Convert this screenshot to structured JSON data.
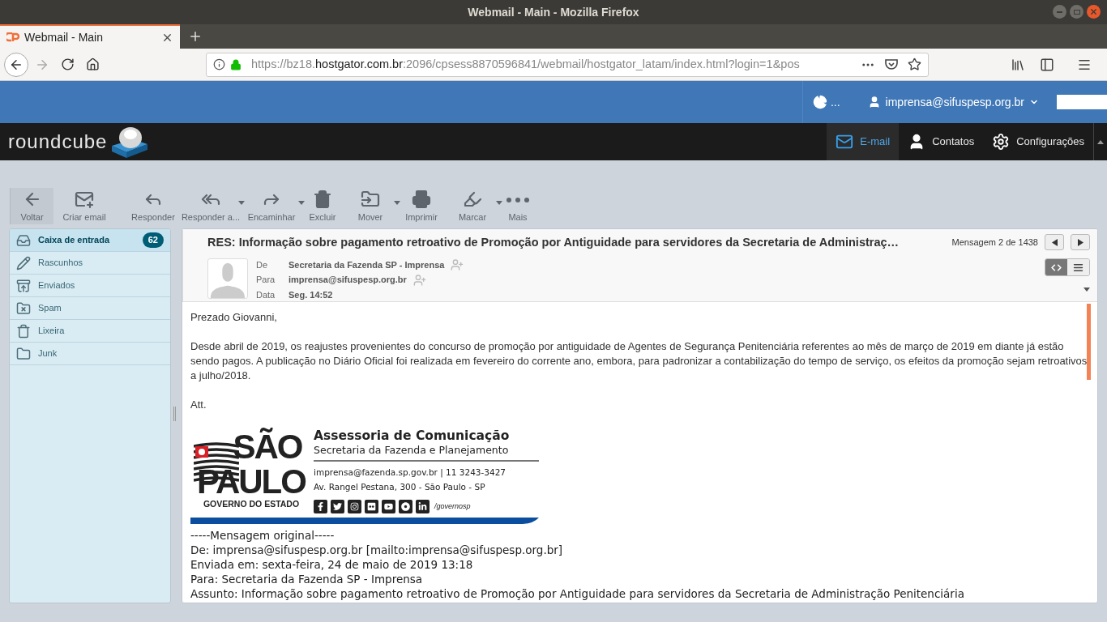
{
  "browser": {
    "window_title": "Webmail - Main - Mozilla Firefox",
    "tab_title": "Webmail - Main",
    "url": {
      "prefix": "https://bz18.",
      "domain": "hostgator.com.br",
      "path": ":2096/cpsess8870596841/webmail/hostgator_latam/index.html?login=1&pos"
    }
  },
  "header": {
    "quota": "...",
    "user": "imprensa@sifuspesp.org.br"
  },
  "logo": {
    "text": "roundcube"
  },
  "nav": [
    {
      "label": "E-mail",
      "kind": "mail",
      "selected": true
    },
    {
      "label": "Contatos",
      "kind": "user",
      "selected": false
    },
    {
      "label": "Configurações",
      "kind": "gear",
      "selected": false
    }
  ],
  "toolbar": [
    {
      "label": "Voltar",
      "kind": "back",
      "dropdown": false
    },
    {
      "label": "Criar email",
      "kind": "compose",
      "dropdown": false
    },
    {
      "label": "Responder",
      "kind": "reply",
      "dropdown": false
    },
    {
      "label": "Responder a...",
      "kind": "reply-all",
      "dropdown": true
    },
    {
      "label": "Encaminhar",
      "kind": "forward",
      "dropdown": true
    },
    {
      "label": "Excluir",
      "kind": "delete",
      "dropdown": false
    },
    {
      "label": "Mover",
      "kind": "move",
      "dropdown": true
    },
    {
      "label": "Imprimir",
      "kind": "print",
      "dropdown": false
    },
    {
      "label": "Marcar",
      "kind": "mark",
      "dropdown": true
    },
    {
      "label": "Mais",
      "kind": "more",
      "dropdown": false
    }
  ],
  "folders": [
    {
      "label": "Caixa de entrada",
      "kind": "inbox",
      "selected": true,
      "count": "62"
    },
    {
      "label": "Rascunhos",
      "kind": "drafts",
      "selected": false
    },
    {
      "label": "Enviados",
      "kind": "sent",
      "selected": false
    },
    {
      "label": "Spam",
      "kind": "spam",
      "selected": false
    },
    {
      "label": "Lixeira",
      "kind": "trash",
      "selected": false
    },
    {
      "label": "Junk",
      "kind": "folder",
      "selected": false
    }
  ],
  "message": {
    "subject": "RES: Informação sobre pagamento retroativo de Promoção por Antiguidade para servidores da Secretaria de Administraç…",
    "counter": "Mensagem 2 de 1438",
    "headers": [
      {
        "label": "De",
        "value": "Secretaria da Fazenda SP - Imprensa",
        "add_contact": true
      },
      {
        "label": "Para",
        "value": "imprensa@sifuspesp.org.br",
        "add_contact": true
      },
      {
        "label": "Data",
        "value": "Seg. 14:52",
        "add_contact": false
      }
    ],
    "view_modes": [
      {
        "kind": "html",
        "selected": true
      },
      {
        "kind": "plain",
        "selected": false
      }
    ],
    "body": [
      "Prezado Giovanni,",
      "Desde abril de 2019, os reajustes provenientes do concurso de promoção por antiguidade de Agentes de Segurança Penitenciária referentes ao mês de março de 2019 em diante já estão sendo pagos. A publicação no Diário Oficial foi realizada em fevereiro do corrente ano, embora, para padronizar a contabilização do tempo de serviço, os efeitos da promoção sejam retroativos a julho/2018.",
      "Att."
    ],
    "signature": {
      "logo_top": "SÃO",
      "logo_bottom": "PAULO",
      "logo_caption": "GOVERNO DO ESTADO",
      "title": "Assessoria de Comunicação",
      "subtitle": "Secretaria da Fazenda e Planejamento",
      "contact": "imprensa@fazenda.sp.gov.br | 11 3243-3427",
      "address": "Av. Rangel Pestana, 300 - São Paulo - SP",
      "social_handle": "/governosp"
    },
    "original": [
      "-----Mensagem original-----",
      "De: imprensa@sifuspesp.org.br [mailto:imprensa@sifuspesp.org.br]",
      "Enviada em: sexta-feira, 24 de maio de 2019 13:18",
      "Para: Secretaria da Fazenda SP - Imprensa",
      "Assunto: Informação sobre pagamento retroativo de Promoção por Antiguidade para servidores da Secretaria de Administração Penitenciária"
    ]
  }
}
